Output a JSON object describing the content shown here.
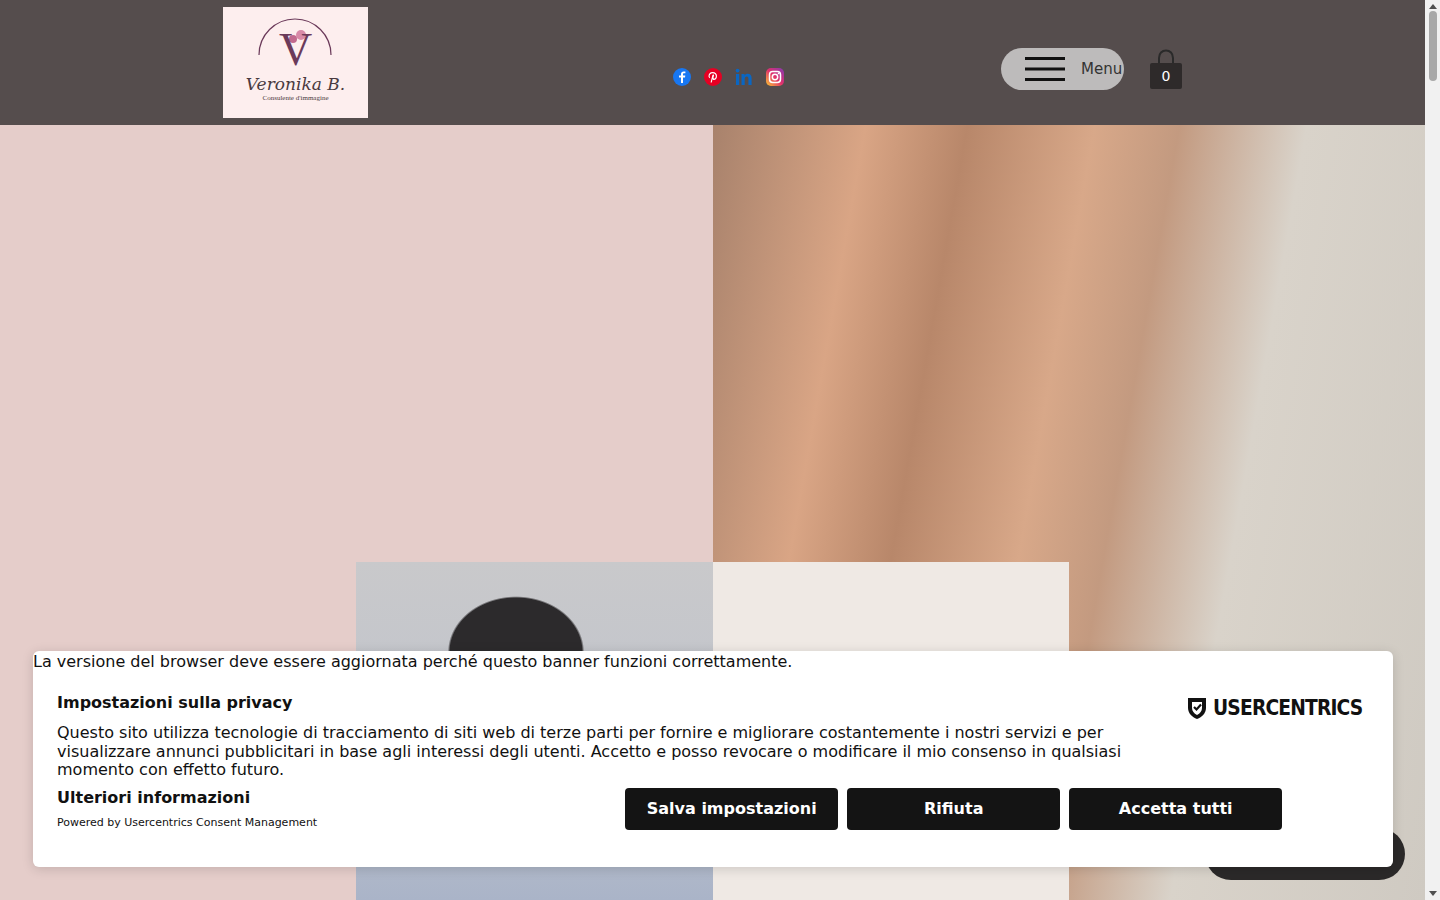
{
  "header": {
    "logo": {
      "monogram": "V",
      "signature": "Veronika B.",
      "tagline": "Consulente d'immagine"
    },
    "menu": {
      "label": "Menu"
    },
    "cart": {
      "count": "0"
    }
  },
  "consent": {
    "notice": "La versione del browser deve essere aggiornata perché questo banner funzioni correttamente.",
    "title": "Impostazioni sulla privacy",
    "body": "Questo sito utilizza tecnologie di tracciamento di siti web di terze parti per fornire e migliorare costantemente i nostri servizi e per visualizzare annunci pubblicitari in base agli interessi degli utenti. Accetto e posso revocare o modificare il mio consenso in qualsiasi momento con effetto futuro.",
    "more_info": "Ulteriori informazioni",
    "powered_by": "Powered by Usercentrics Consent Management",
    "brand": "USERCENTRICS",
    "buttons": [
      "Salva impostazioni",
      "Rifiuta",
      "Accetta tutti"
    ]
  }
}
